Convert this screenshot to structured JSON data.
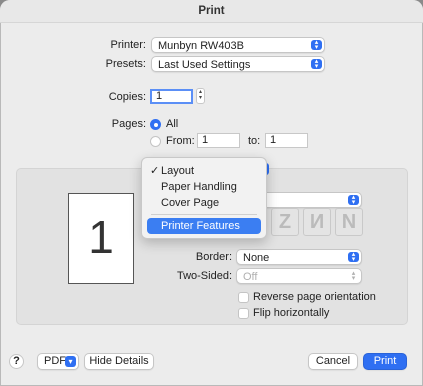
{
  "window": {
    "title": "Print"
  },
  "printer": {
    "label": "Printer:",
    "value": "Munbyn RW403B"
  },
  "presets": {
    "label": "Presets:",
    "value": "Last Used Settings"
  },
  "copies": {
    "label": "Copies:",
    "value": "1"
  },
  "pages": {
    "label": "Pages:",
    "all_label": "All",
    "from_label": "From:",
    "from_value": "1",
    "to_label": "to:",
    "to_value": "1",
    "selected": "All"
  },
  "section_menu": {
    "items": [
      {
        "label": "Layout",
        "checked": true
      },
      {
        "label": "Paper Handling"
      },
      {
        "label": "Cover Page"
      },
      {
        "label": "Printer Features",
        "highlighted": true
      }
    ]
  },
  "preview": {
    "page_number": "1"
  },
  "layout_direction_icons": [
    "Z",
    "И",
    "N"
  ],
  "border": {
    "label": "Border:",
    "value": "None"
  },
  "two_sided": {
    "label": "Two-Sided:",
    "value": "Off"
  },
  "reverse_orientation": {
    "label": "Reverse page orientation",
    "checked": false
  },
  "flip_horizontally": {
    "label": "Flip horizontally",
    "checked": false
  },
  "footer": {
    "help": "?",
    "pdf": "PDF",
    "hide_details": "Hide Details",
    "cancel": "Cancel",
    "print": "Print"
  },
  "colors": {
    "accent": "#2f6ff2",
    "highlight": "#3b7ef2"
  }
}
